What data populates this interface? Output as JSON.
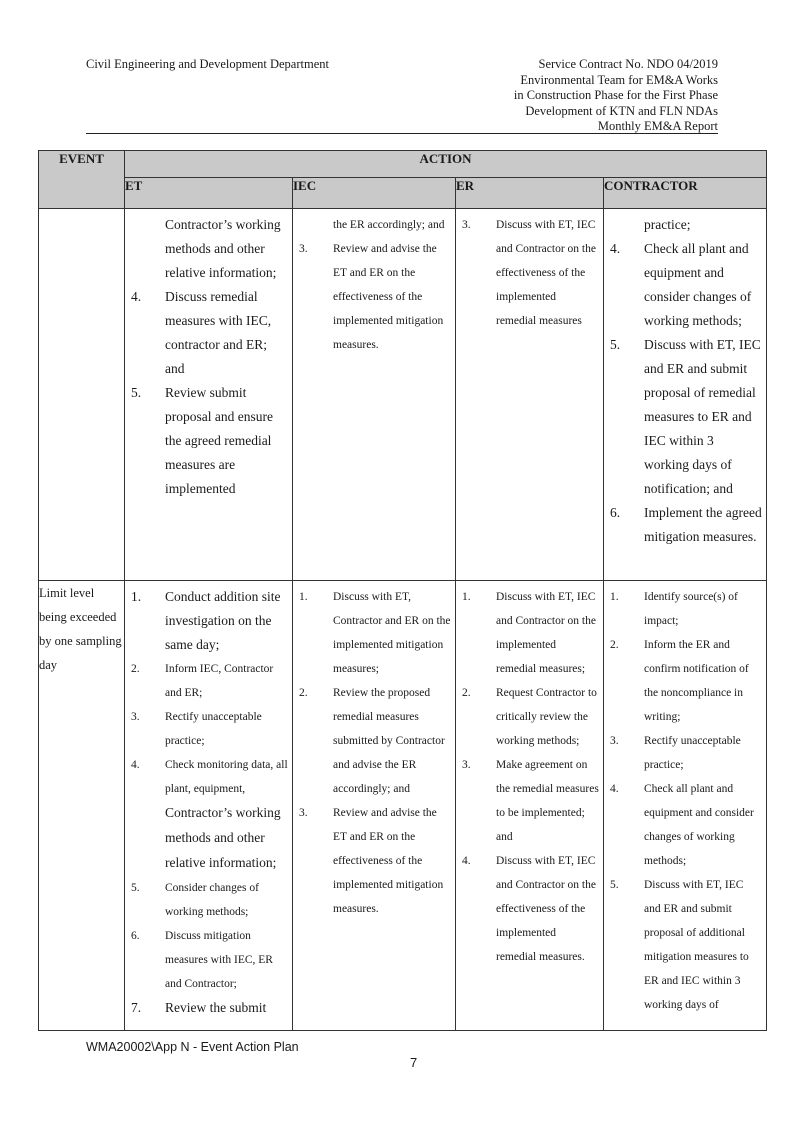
{
  "header": {
    "left": "Civil Engineering and Development Department",
    "right_lines": [
      "Service Contract No. NDO 04/2019",
      "Environmental Team for EM&A Works",
      "in Construction Phase for the First Phase",
      "Development of KTN and FLN NDAs",
      "Monthly EM&A Report"
    ]
  },
  "table": {
    "headers": {
      "event": "EVENT",
      "action": "ACTION",
      "et": "ET",
      "iec": "IEC",
      "er": "ER",
      "contractor": "CONTRACTOR"
    },
    "rows": [
      {
        "event": "",
        "et": {
          "continued": "Contractor’s working methods and other relative information;",
          "items": [
            {
              "num": "4.",
              "text": "Discuss remedial measures with IEC, contractor and ER; and"
            },
            {
              "num": "5.",
              "text": "Review submit proposal and ensure the agreed remedial measures are implemented"
            }
          ]
        },
        "iec": {
          "continued": "the ER accordingly; and",
          "items": [
            {
              "num": "3.",
              "text": "Review and advise the ET and ER on the effectiveness of the implemented mitigation measures."
            }
          ]
        },
        "er": {
          "continued": "",
          "items": [
            {
              "num": "3.",
              "text": "Discuss with ET, IEC and Contractor on the effectiveness of the implemented remedial measures"
            }
          ]
        },
        "contractor": {
          "continued": "practice;",
          "items": [
            {
              "num": "4.",
              "text": "Check all plant and equipment and consider changes of working methods;"
            },
            {
              "num": "5.",
              "text": "Discuss with ET, IEC and ER and submit proposal of remedial measures to ER and IEC within 3 working days of notification; and"
            },
            {
              "num": "6.",
              "text": "Implement the agreed mitigation measures."
            }
          ]
        }
      },
      {
        "event": "Limit level being exceeded by one sampling day",
        "et": {
          "items": [
            {
              "num": "1.",
              "text": "Conduct addition site investigation on the same day;"
            },
            {
              "num": "2.",
              "text": "Inform IEC, Contractor and ER;"
            },
            {
              "num": "3.",
              "text": "Rectify unacceptable practice;"
            },
            {
              "num": "4.",
              "text": "Check monitoring data, all plant, equipment,",
              "text2": "Contractor’s working methods and other relative information;"
            },
            {
              "num": "5.",
              "text": "Consider changes of working methods;"
            },
            {
              "num": "6.",
              "text": "Discuss mitigation measures with IEC, ER and Contractor;"
            },
            {
              "num": "7.",
              "text": "Review the submit"
            }
          ]
        },
        "iec": {
          "items": [
            {
              "num": "1.",
              "text": "Discuss with ET, Contractor and ER on the implemented mitigation measures;"
            },
            {
              "num": "2.",
              "text": "Review the proposed remedial measures submitted by Contractor and advise the ER accordingly; and"
            },
            {
              "num": "3.",
              "text": "Review and advise the ET and ER on the effectiveness of the implemented mitigation measures."
            }
          ]
        },
        "er": {
          "items": [
            {
              "num": "1.",
              "text": "Discuss with ET, IEC and Contractor on the implemented remedial measures;"
            },
            {
              "num": "2.",
              "text": "Request Contractor to critically review the working methods;"
            },
            {
              "num": "3.",
              "text": "Make agreement on the remedial measures to be implemented; and"
            },
            {
              "num": "4.",
              "text": "Discuss with ET, IEC and Contractor on the effectiveness of the implemented remedial measures."
            }
          ]
        },
        "contractor": {
          "items": [
            {
              "num": "1.",
              "text": "Identify source(s) of impact;"
            },
            {
              "num": "2.",
              "text": "Inform the ER and confirm notification of the noncompliance in writing;"
            },
            {
              "num": "3.",
              "text": "Rectify unacceptable practice;"
            },
            {
              "num": "4.",
              "text": "Check all plant and equipment and consider changes of working methods;"
            },
            {
              "num": "5.",
              "text": "Discuss with ET, IEC and ER and submit proposal of additional mitigation measures to ER and IEC within 3 working days of"
            }
          ]
        }
      }
    ]
  },
  "footer": {
    "doc_ref": "WMA20002\\App N - Event Action Plan",
    "page_number": "7"
  }
}
